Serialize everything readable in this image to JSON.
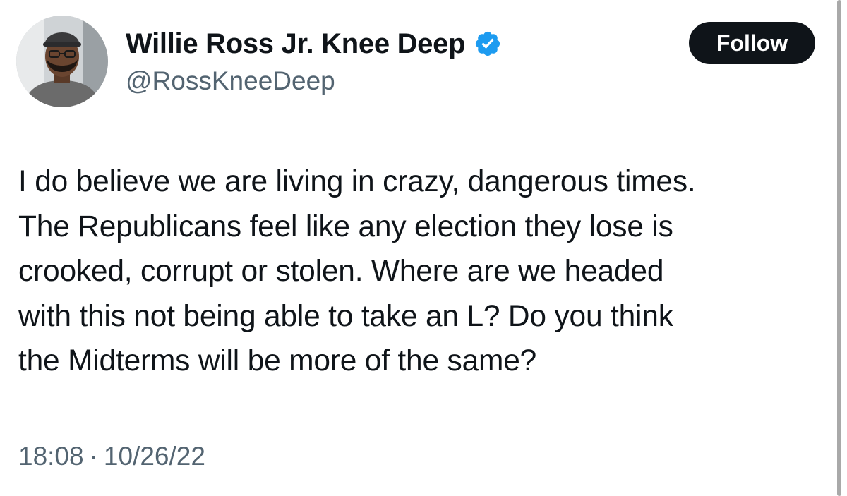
{
  "user": {
    "display_name": "Willie Ross Jr. Knee Deep",
    "handle": "@RossKneeDeep",
    "verified": true
  },
  "follow_button": {
    "label": "Follow"
  },
  "tweet": {
    "text": "I do believe we are living in crazy, dangerous times.\nThe Republicans feel like any election they lose is\ncrooked, corrupt or stolen. Where are we headed\nwith this not being able to take an L? Do you think\nthe Midterms will be more of the same?",
    "time": "18:08",
    "separator": "·",
    "date": "10/26/22"
  },
  "icons": {
    "verified": "verified-badge-icon"
  },
  "colors": {
    "text_primary": "#0f1419",
    "text_secondary": "#536471",
    "verified_blue": "#1d9bf0",
    "button_bg": "#0f1419",
    "button_text": "#ffffff"
  }
}
